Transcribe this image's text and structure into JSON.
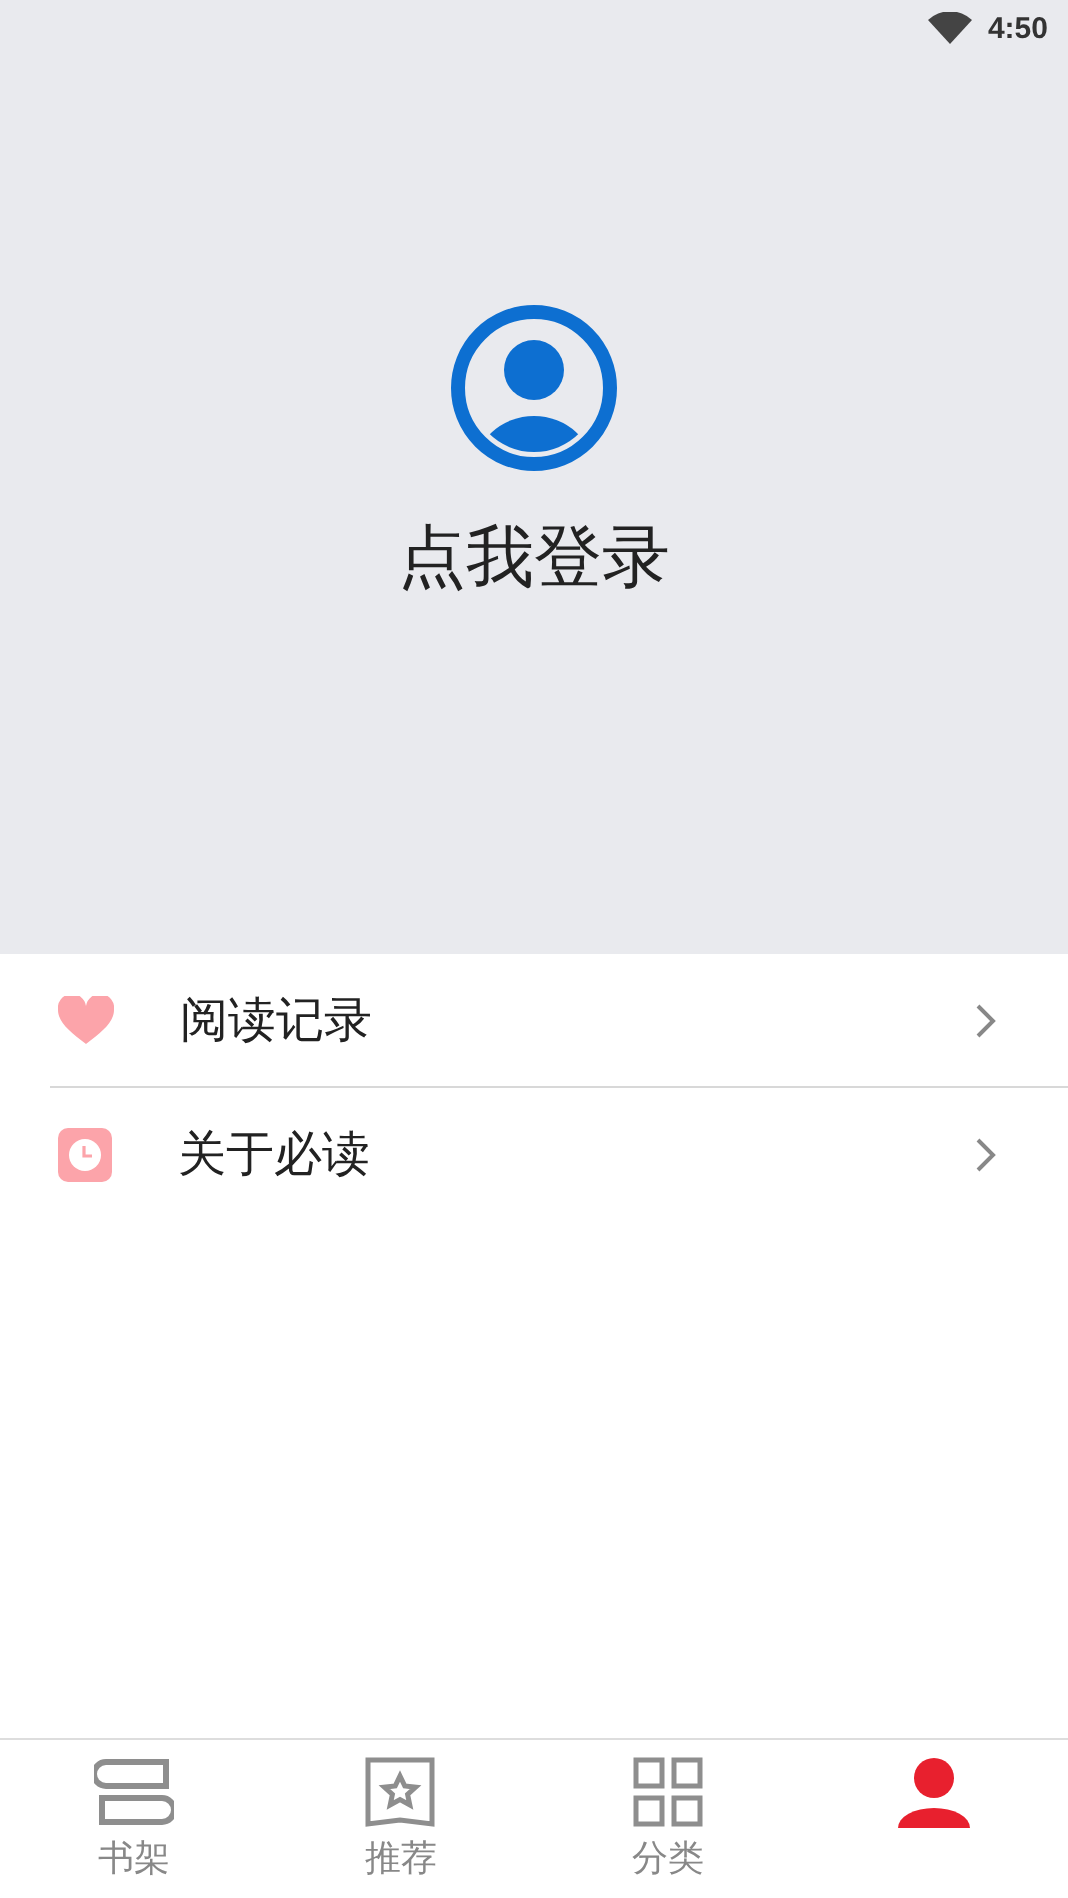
{
  "status_bar": {
    "time": "4:50"
  },
  "header": {
    "login_label": "点我登录"
  },
  "menu": [
    {
      "kind": "heart",
      "label": "阅读记录"
    },
    {
      "kind": "clock",
      "label": "关于必读"
    }
  ],
  "bottom_nav": [
    {
      "kind": "shelf",
      "label": "书架",
      "selected": false
    },
    {
      "kind": "star",
      "label": "推荐",
      "selected": false
    },
    {
      "kind": "grid",
      "label": "分类",
      "selected": false
    },
    {
      "kind": "person",
      "selected": true
    }
  ]
}
